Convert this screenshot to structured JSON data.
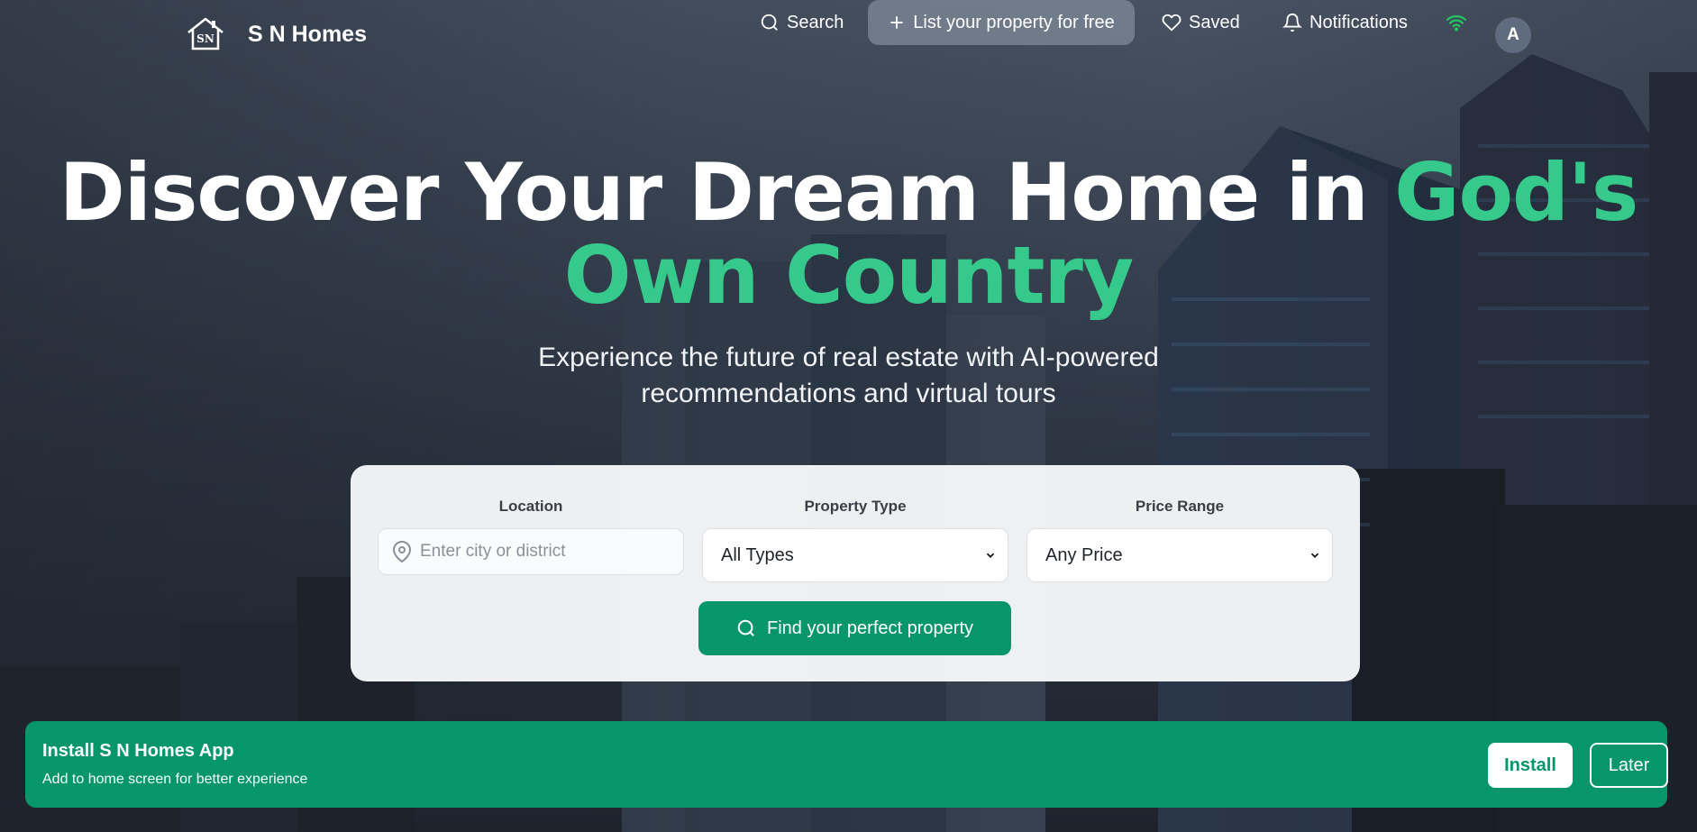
{
  "header": {
    "brand": "S N Homes",
    "logo_monogram": "SN",
    "nav": {
      "search": "Search",
      "list_property": "List your property for free",
      "saved": "Saved",
      "notifications": "Notifications"
    },
    "avatar_initial": "A"
  },
  "hero": {
    "title_part1": "Discover Your Dream Home in ",
    "title_accent": "God's Own Country",
    "subtitle_line1": "Experience the future of real estate with AI-powered",
    "subtitle_line2": "recommendations and virtual tours"
  },
  "search": {
    "location_label": "Location",
    "location_placeholder": "Enter city or district",
    "property_type_label": "Property Type",
    "property_type_value": "All Types",
    "price_range_label": "Price Range",
    "price_range_value": "Any Price",
    "submit_label": "Find your perfect property"
  },
  "install_banner": {
    "title": "Install S N Homes App",
    "subtitle": "Add to home screen for better experience",
    "install_label": "Install",
    "later_label": "Later"
  },
  "colors": {
    "accent": "#35c98c",
    "primary_green": "#079669",
    "wifi_status": "#22c55e"
  },
  "icons": {
    "logo": "house-icon",
    "search": "search-icon",
    "list": "plus-icon",
    "saved": "heart-icon",
    "notifications": "bell-icon",
    "connection": "wifi-icon",
    "location": "map-pin-icon",
    "select": "chevron-down-icon"
  }
}
